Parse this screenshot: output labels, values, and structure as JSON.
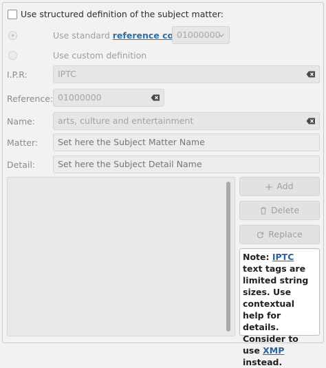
{
  "checkbox_label": "Use structured definition of the subject matter:",
  "standard": {
    "prefix": "Use standard",
    "link": "reference code",
    "combo_value": "01000000"
  },
  "custom_label": "Use custom definition",
  "fields": {
    "ipr": {
      "label": "I.P.R:",
      "value": "IPTC"
    },
    "reference": {
      "label": "Reference:",
      "value": "01000000"
    },
    "name": {
      "label": "Name:",
      "value": "arts, culture and entertainment"
    },
    "matter": {
      "label": "Matter:",
      "placeholder": "Set here the Subject Matter Name"
    },
    "detail": {
      "label": "Detail:",
      "placeholder": "Set here the Subject Detail Name"
    }
  },
  "buttons": {
    "add": "Add",
    "delete": "Delete",
    "replace": "Replace"
  },
  "note": {
    "lead": "Note: ",
    "iptc": "IPTC",
    "mid": " text tags are limited string sizes. Use contextual help for details. Consider to use ",
    "xmp": "XMP",
    "tail": " instead."
  },
  "icons": {
    "clear": "backspace-clear-icon",
    "add": "plus-icon",
    "delete": "trash-icon",
    "replace": "refresh-icon",
    "combo": "chevron-down-icon"
  }
}
